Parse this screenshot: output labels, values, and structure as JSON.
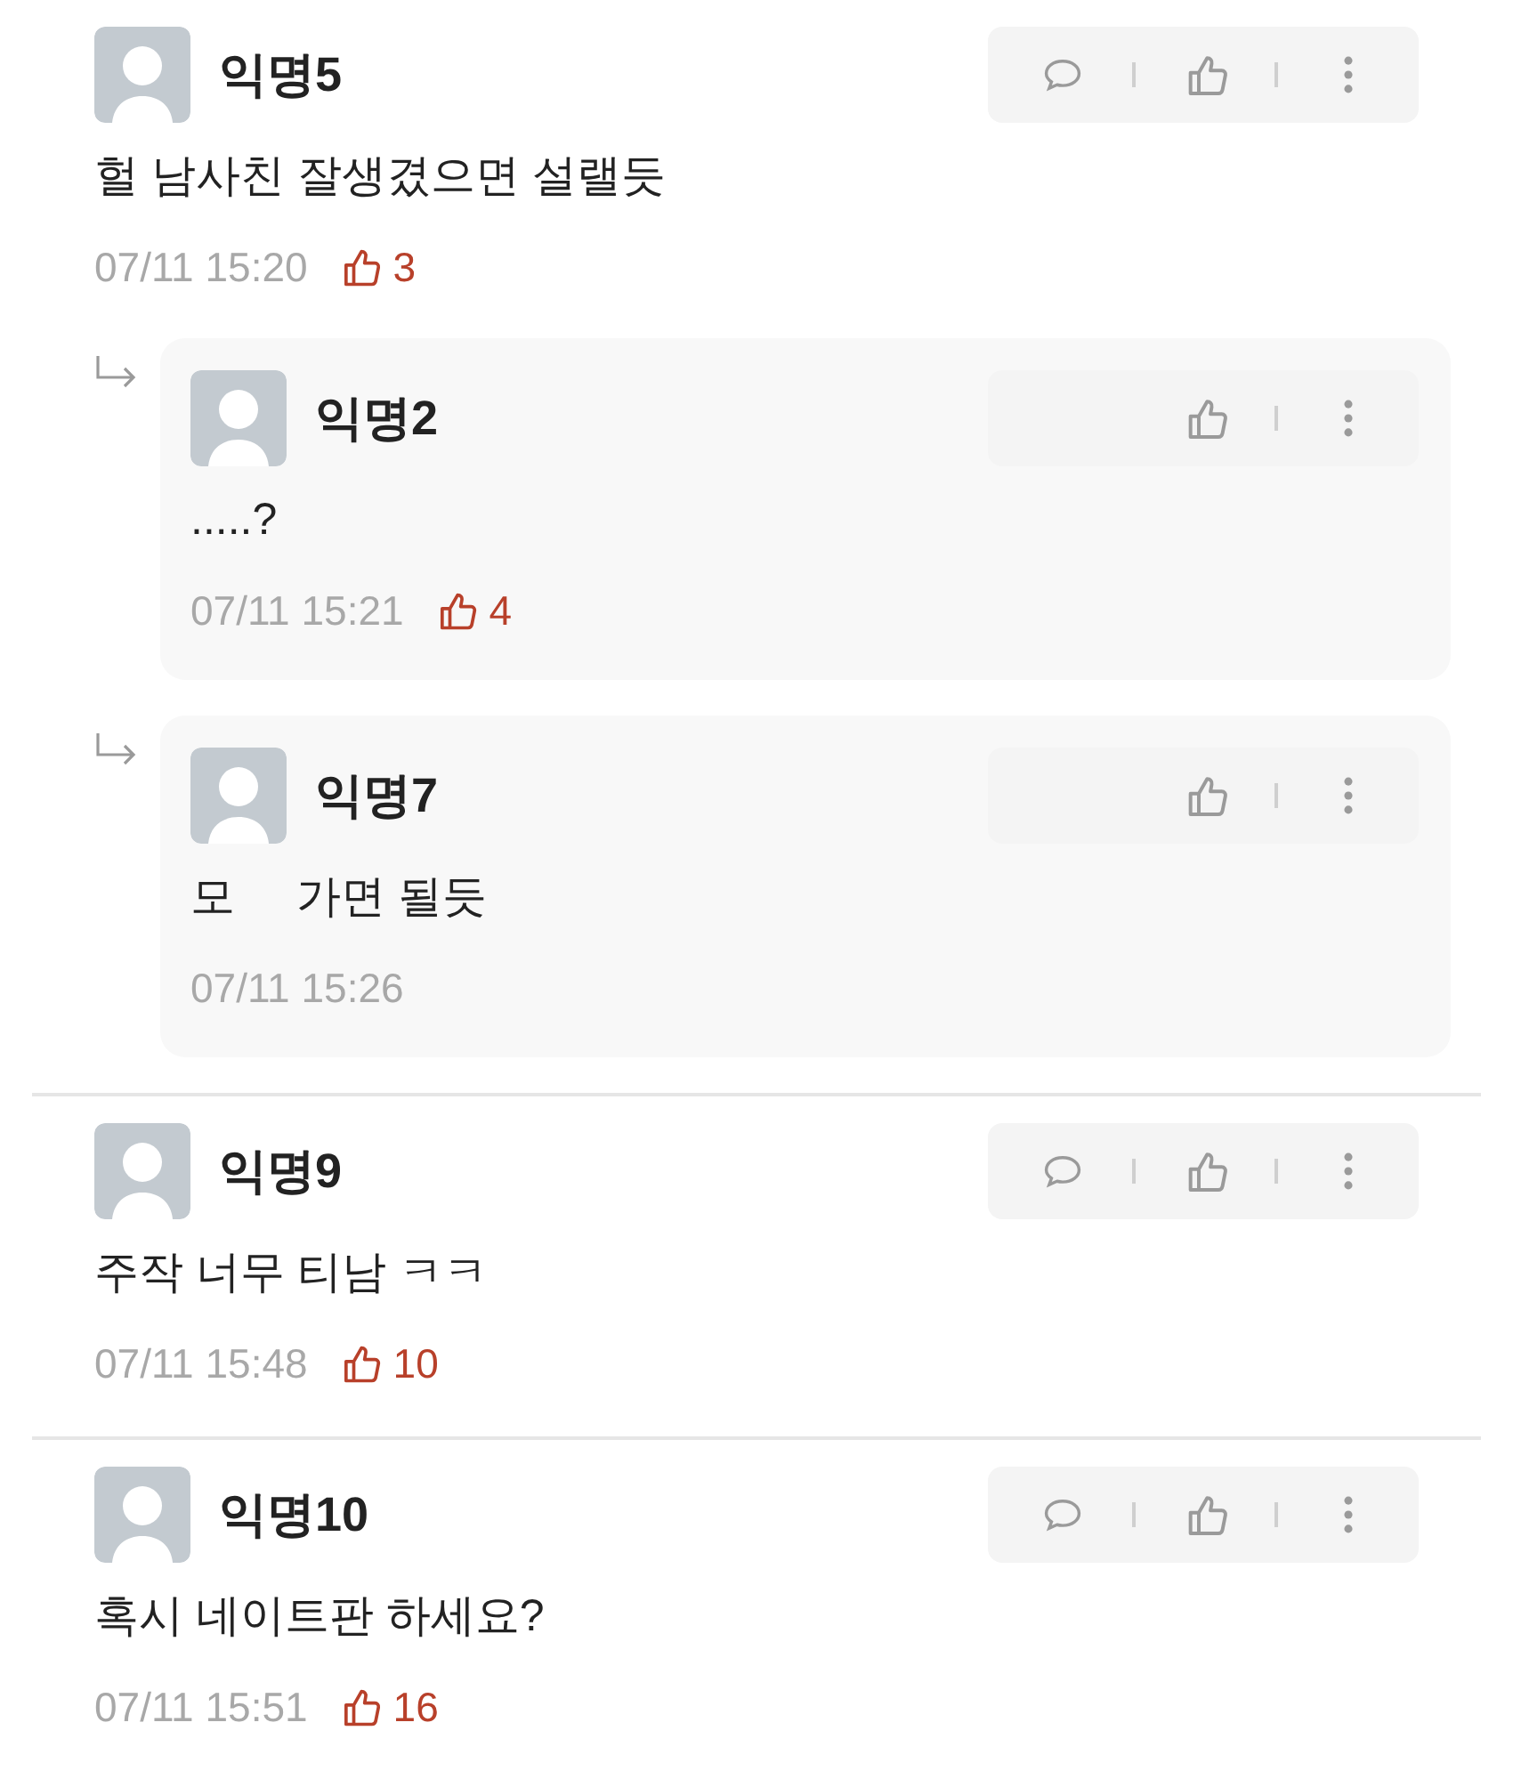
{
  "comments": [
    {
      "name": "익명5",
      "text": "헐 남사친 잘생겼으면 설랠듯",
      "time": "07/11 15:20",
      "likes": "3",
      "children": [
        {
          "name": "익명2",
          "text": ".....?",
          "time": "07/11 15:21",
          "likes": "4"
        },
        {
          "name": "익명7",
          "text": "모     가면 될듯",
          "time": "07/11 15:26"
        }
      ]
    },
    {
      "name": "익명9",
      "text": "주작 너무 티남 ㅋㅋ",
      "time": "07/11 15:48",
      "likes": "10"
    },
    {
      "name": "익명10",
      "text": "혹시 네이트판 하세요?",
      "time": "07/11 15:51",
      "likes": "16"
    }
  ]
}
